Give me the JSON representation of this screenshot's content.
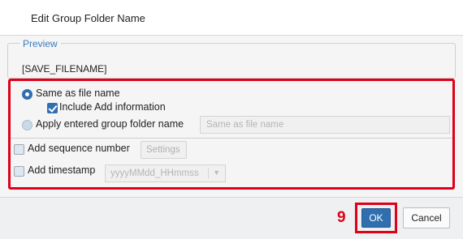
{
  "dialog": {
    "title": "Edit Group Folder Name"
  },
  "preview": {
    "legend": "Preview",
    "value": "[SAVE_FILENAME]"
  },
  "options": {
    "same_as_file_name": {
      "label": "Same as file name",
      "selected": true
    },
    "include_add_information": {
      "label": "Include Add information",
      "checked": true
    },
    "apply_entered_name": {
      "label": "Apply entered group folder name",
      "selected": false,
      "input_value": "Same as file name"
    },
    "add_sequence_number": {
      "label": "Add sequence number",
      "checked": false,
      "settings_label": "Settings"
    },
    "add_timestamp": {
      "label": "Add timestamp",
      "checked": false,
      "format_value": "yyyyMMdd_HHmmss"
    }
  },
  "annotation": {
    "step_number": "9",
    "highlight_color": "#e0001a"
  },
  "footer": {
    "ok_label": "OK",
    "cancel_label": "Cancel"
  },
  "colors": {
    "accent": "#2f6fb0",
    "legend": "#3a7bbf"
  }
}
